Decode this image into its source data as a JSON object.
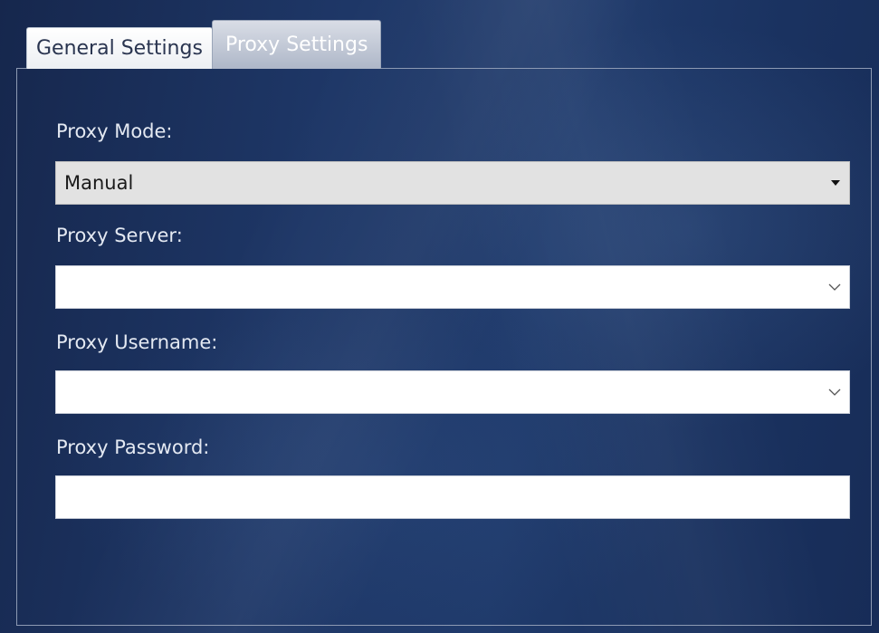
{
  "tabs": [
    {
      "label": "General Settings",
      "active": false
    },
    {
      "label": "Proxy Settings",
      "active": true
    }
  ],
  "proxy": {
    "mode_label": "Proxy Mode:",
    "mode_value": "Manual",
    "server_label": "Proxy Server:",
    "server_value": "",
    "username_label": "Proxy Username:",
    "username_value": "",
    "password_label": "Proxy Password:",
    "password_value": ""
  },
  "icons": {
    "mode_arrow": "caret-down-icon",
    "server_arrow": "chevron-down-icon",
    "username_arrow": "chevron-down-icon"
  },
  "colors": {
    "background": "#1c3460",
    "active_tab": "#aeb7c8",
    "label_text": "#e4e9f2",
    "combo_mode_bg": "#e2e2e2"
  }
}
